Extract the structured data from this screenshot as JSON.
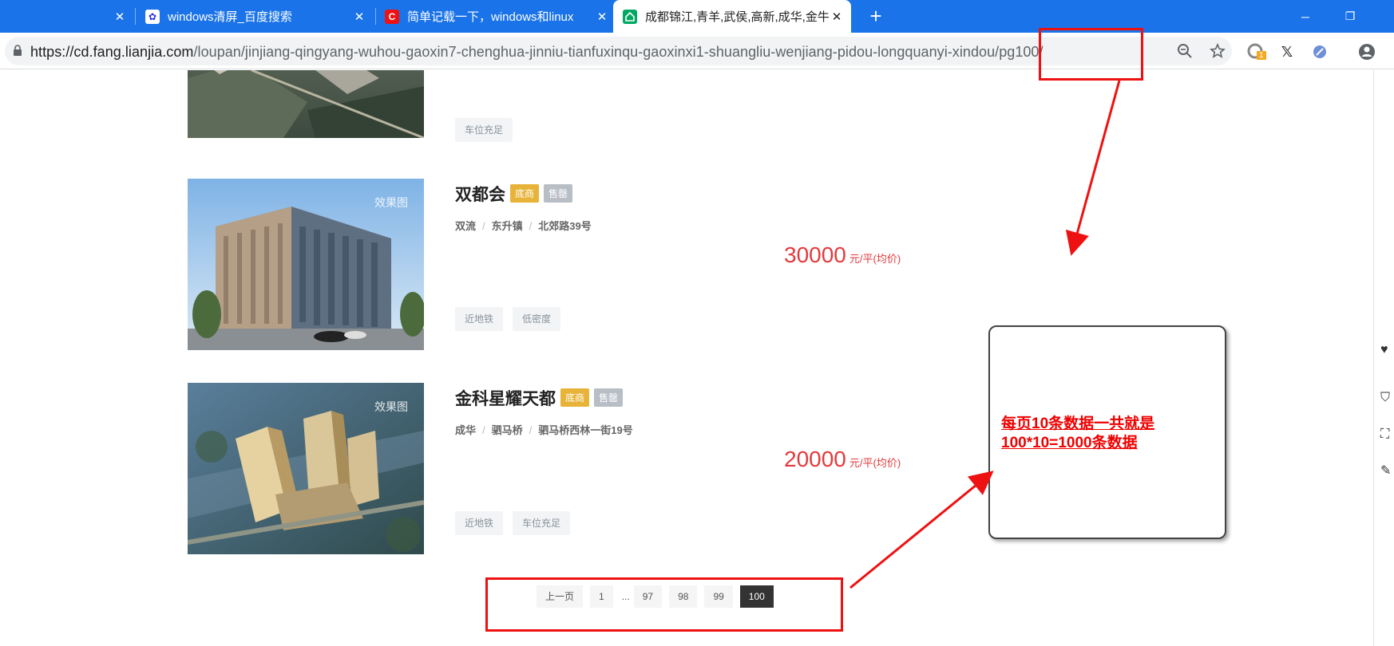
{
  "browser": {
    "tabs": [
      {
        "title": "windows清屏_百度搜索",
        "favicon": "baidu-paw-icon",
        "active": false
      },
      {
        "title": "简单记载一下，windows和linux",
        "favicon": "csdn-icon",
        "active": false
      },
      {
        "title": "成都锦江,青羊,武侯,高新,成华,金牛",
        "favicon": "lianjia-house-icon",
        "active": true
      }
    ],
    "new_tab_label": "+",
    "url_host": "https://cd.fang.lianjia.com",
    "url_path": "/loupan/jinjiang-qingyang-wuhou-gaoxin7-chenghua-jinniu-tianfuxinqu-gaoxinxi1-shuangliu-wenjiang-pidou-longquanyi-xindou/pg100/",
    "extension_badge": "1"
  },
  "listings": [
    {
      "tags": [
        "车位充足"
      ]
    },
    {
      "name": "双都会",
      "badges": [
        "底商",
        "售罄"
      ],
      "district": "双流",
      "area": "东升镇",
      "street": "北郊路39号",
      "price": "30000",
      "price_unit": "元/平(均价)",
      "watermark": "效果图",
      "tags": [
        "近地铁",
        "低密度"
      ]
    },
    {
      "name": "金科星耀天都",
      "badges": [
        "底商",
        "售罄"
      ],
      "district": "成华",
      "area": "驷马桥",
      "street": "驷马桥西林一街19号",
      "price": "20000",
      "price_unit": "元/平(均价)",
      "watermark": "效果图",
      "tags": [
        "近地铁",
        "车位充足"
      ]
    }
  ],
  "pagination": {
    "prev": "上一页",
    "first": "1",
    "ellipsis": "...",
    "pages": [
      "97",
      "98",
      "99"
    ],
    "current": "100"
  },
  "annotation": {
    "line1": "每页10条数据一共就是",
    "line2": "100*10=1000条数据"
  },
  "colors": {
    "chrome_blue": "#1a73e8",
    "price_red": "#e4393c",
    "annotation_red": "#e11111",
    "badge_yellow": "#e7b339",
    "badge_grey": "#b8bec6"
  }
}
